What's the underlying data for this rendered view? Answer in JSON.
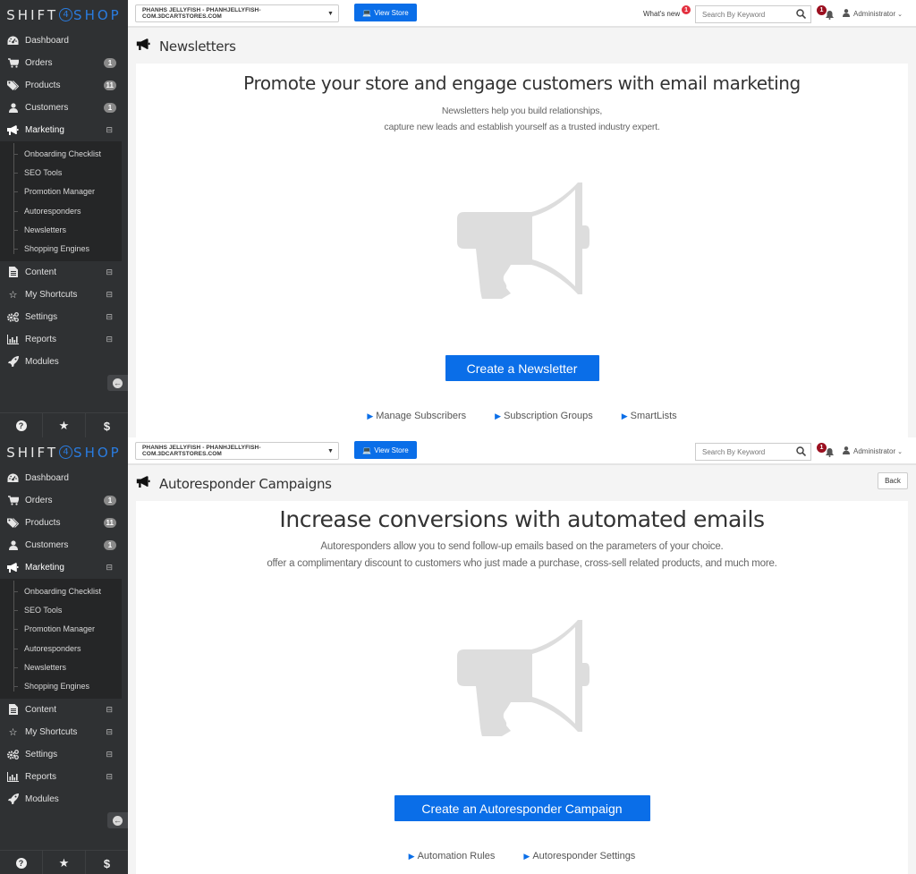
{
  "brand": {
    "part1": "SHIFT",
    "digit": "4",
    "part2": "SHOP"
  },
  "sidebar": {
    "items": [
      {
        "label": "Dashboard",
        "icon": "dashboard-icon",
        "badge": null
      },
      {
        "label": "Orders",
        "icon": "cart-icon",
        "badge": "1"
      },
      {
        "label": "Products",
        "icon": "tags-icon",
        "badge": "11"
      },
      {
        "label": "Customers",
        "icon": "user-icon",
        "badge": "1"
      },
      {
        "label": "Marketing",
        "icon": "bullhorn-icon",
        "expander": "⊟"
      }
    ],
    "marketing_sub": [
      "Onboarding Checklist",
      "SEO Tools",
      "Promotion Manager",
      "Autoresponders",
      "Newsletters",
      "Shopping Engines"
    ],
    "items_after": [
      {
        "label": "Content",
        "icon": "file-icon",
        "expander": "⊟"
      },
      {
        "label": "My Shortcuts",
        "icon": "star-outline-icon",
        "expander": "⊟"
      },
      {
        "label": "Settings",
        "icon": "gears-icon",
        "expander": "⊟"
      },
      {
        "label": "Reports",
        "icon": "bar-chart-icon",
        "expander": "⊟"
      },
      {
        "label": "Modules",
        "icon": "rocket-icon",
        "expander": null
      }
    ],
    "bottom": [
      {
        "icon": "help-icon",
        "glyph": "?"
      },
      {
        "icon": "star-icon",
        "glyph": "★"
      },
      {
        "icon": "dollar-icon",
        "glyph": "$"
      }
    ]
  },
  "topbar": {
    "store": "PHANHS JELLYFISH - PHANHJELLYFISH-COM.3DCARTSTORES.COM",
    "view_store": "View Store",
    "whats_new": "What's new",
    "whats_new_count": "1",
    "search_placeholder": "Search By Keyword",
    "notifications_count": "1",
    "user": "Administrator"
  },
  "screens": [
    {
      "page_title": "Newsletters",
      "hero_title": "Promote your store and engage customers with email marketing",
      "desc_line1": "Newsletters help you build relationships,",
      "desc_line2": "capture new leads and establish yourself as a trusted industry expert.",
      "cta": "Create a Newsletter",
      "links": [
        "Manage Subscribers",
        "Subscription Groups",
        "SmartLists"
      ]
    },
    {
      "page_title": "Autoresponder Campaigns",
      "back": "Back",
      "hero_title": "Increase conversions with automated emails",
      "desc_line1": "Autoresponders allow you to send follow-up emails based on the parameters of your choice.",
      "desc_line2": "offer a complimentary discount to customers who just made a purchase, cross-sell related products, and much more.",
      "cta": "Create an Autoresponder Campaign",
      "links": [
        "Automation Rules",
        "Autoresponder Settings"
      ]
    }
  ],
  "colors": {
    "accent": "#0a6ee8",
    "sidebar_bg": "#2f3133",
    "badge_red": "#e3303f",
    "notif_red": "#9b1020"
  }
}
